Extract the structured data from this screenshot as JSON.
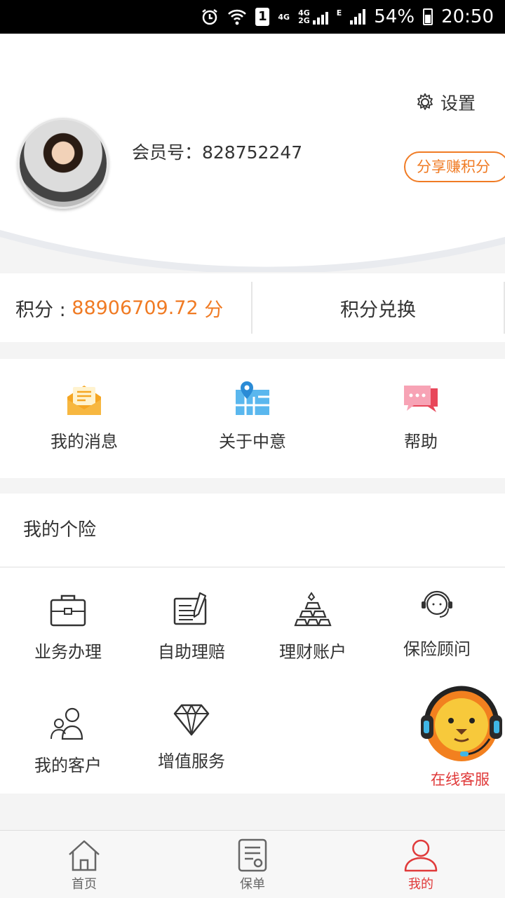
{
  "status_bar": {
    "icons": [
      "alarm-icon",
      "wifi-icon",
      "sim-1-icon",
      "signal-4g-icon",
      "signal-2g-icon",
      "edge-signal-icon",
      "battery-icon"
    ],
    "sim": "1",
    "net_4g": "4G",
    "net_4g2g_top": "4G",
    "net_4g2g_bottom": "2G",
    "net_e": "E",
    "battery": "54%",
    "time": "20:50"
  },
  "profile": {
    "settings_label": "设置",
    "member_label": "会员号：828752247",
    "share_button": "分享赚积分"
  },
  "points": {
    "label": "积分 : ",
    "value": "88906709.72",
    "unit": " 分",
    "exchange_label": "积分兑换"
  },
  "quick_actions": [
    {
      "label": "我的消息",
      "icon": "envelope-icon"
    },
    {
      "label": "关于中意",
      "icon": "map-pin-icon"
    },
    {
      "label": "帮助",
      "icon": "chat-bubble-icon"
    }
  ],
  "insurance": {
    "title": "我的个险",
    "items": [
      {
        "label": "业务办理",
        "icon": "briefcase-icon"
      },
      {
        "label": "自助理赔",
        "icon": "edit-document-icon"
      },
      {
        "label": "理财账户",
        "icon": "gold-bars-icon"
      },
      {
        "label": "保险顾问",
        "icon": "headset-agent-icon"
      },
      {
        "label": "我的客户",
        "icon": "customers-icon"
      },
      {
        "label": "增值服务",
        "icon": "diamond-icon"
      }
    ]
  },
  "customer_service": {
    "label": "在线客服",
    "icon": "lion-mascot-icon"
  },
  "tabbar": [
    {
      "label": "首页",
      "icon": "home-icon"
    },
    {
      "label": "保单",
      "icon": "policy-icon"
    },
    {
      "label": "我的",
      "icon": "user-icon",
      "active": true
    }
  ],
  "colors": {
    "accent": "#f07b24",
    "active": "#e03a3a"
  }
}
